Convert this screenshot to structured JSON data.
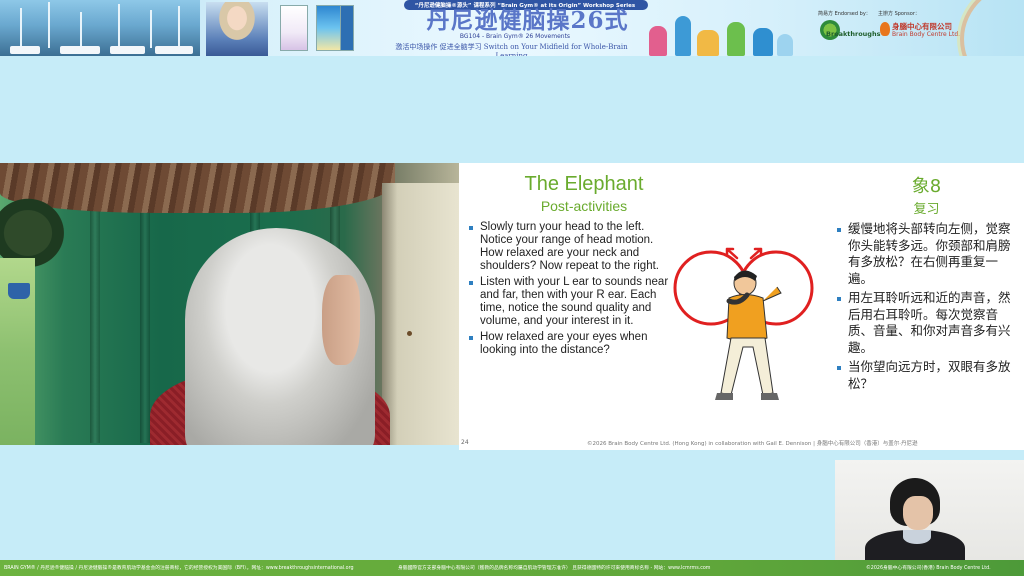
{
  "banner": {
    "series_line": "“丹尼逊健脑操®源头” 课程系列 “Brain Gym® at its Origin” Workshop Series",
    "main_title": "丹尼逊健脑操26式",
    "course_line": "BG104 - Brain Gym® 26 Movements",
    "tagline": "激活中场操作 促进全脑学习 Switch on Your Midfield for Whole-Brain Learning",
    "endorsed_label": "简易方 Endorsed by：",
    "sponsor_label": "主辦方 Sponsor：",
    "endorser_name": "Breakthroughs",
    "sponsor_name_cn": "身腦中心有限公司",
    "sponsor_name_en": "Brain Body Centre Ltd."
  },
  "slide": {
    "title_en": "The Elephant",
    "subtitle_en": "Post-activities",
    "title_cn": "象8",
    "subtitle_cn": "复习",
    "bullets_en": [
      "Slowly turn your head to the left. Notice your range of head motion. How relaxed are your neck and shoulders? Now repeat to the right.",
      "Listen with your L ear to sounds near and far, then with your R ear. Each time, notice the sound quality and volume, and your interest in it.",
      "How relaxed are your eyes when looking into the distance?"
    ],
    "bullets_cn": [
      "缓慢地将头部转向左侧，觉察你头能转多远。你颈部和肩膀有多放松？在右侧再重复一遍。",
      "用左耳聆听远和近的声音，然后用右耳聆听。每次觉察音质、音量、和你对声音多有兴趣。",
      "当你望向远方时，双眼有多放松？"
    ],
    "page_number": "24",
    "copyright": "©2026 Brain Body Centre Ltd. (Hong Kong) in collaboration with Gail E. Dennison | 身腦中心有限公司（香港）与盖尔·丹尼逊",
    "colors": {
      "title_green": "#6aab2e",
      "bullet_blue": "#2e7fc0",
      "circle_red": "#e02020"
    }
  },
  "footer": {
    "left": "BRAIN GYM® / 丹尼逊®健脑操 / 丹尼逊健腦操®是教育肌动学基金会的注册商标，它的经营授权为美国际（BFI）。网址：www.breakthroughsinternational.org",
    "middle": "身腦國際官方支部身腦中心有限公司（獲教的品牌名称均屬自肌动学管理方准许） 且获得德國特的许可來使用商标名称 - 网站：www.lcmrms.com",
    "right": "©2026身腦中心有限公司(香港) Brain Body Centre Ltd."
  }
}
